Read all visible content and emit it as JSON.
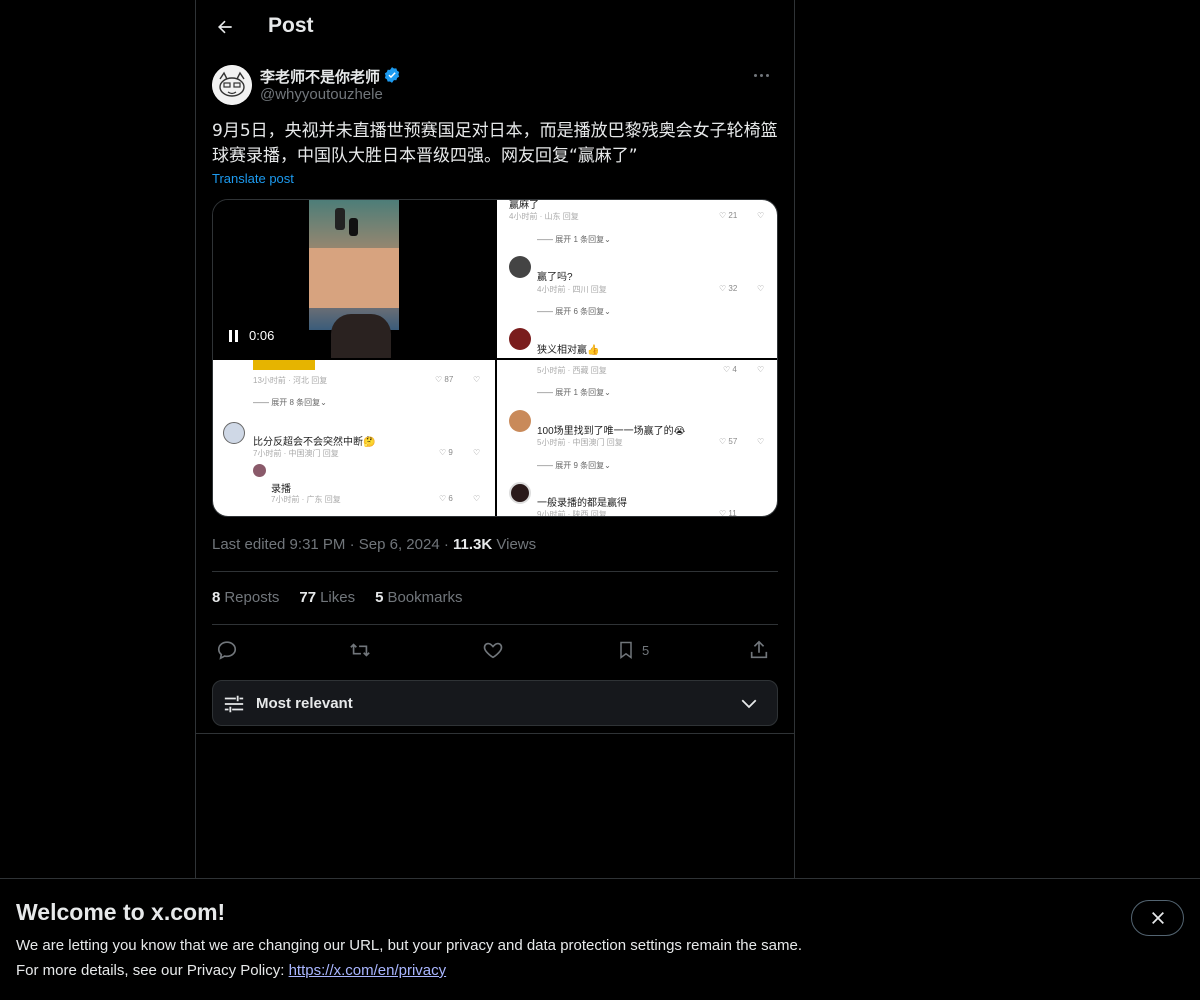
{
  "header": {
    "title": "Post"
  },
  "author": {
    "display_name": "李老师不是你老师",
    "handle": "@whyyoutouzhele"
  },
  "post": {
    "text": "9月5日，央视并未直播世预赛国足对日本，而是播放巴黎残奥会女子轮椅篮球赛录播，中国队大胜日本晋级四强。网友回复“赢麻了”",
    "translate_label": "Translate post"
  },
  "media": {
    "video_time": "0:06",
    "top_right": {
      "c1": {
        "text": "赢麻了",
        "meta": "4小时前 · 山东    回复",
        "likes": "21"
      },
      "c1_expand": "展开 1 条回复",
      "c2": {
        "text": "赢了吗?",
        "meta": "4小时前 · 四川    回复",
        "likes": "32"
      },
      "c2_expand": "展开 6 条回复",
      "c3": {
        "text": "狭义相对赢👍"
      }
    },
    "bottom_left": {
      "c0": {
        "meta": "13小时前 · 河北    回复",
        "likes": "87"
      },
      "c0_expand": "展开 8 条回复",
      "c1": {
        "text": "比分反超会不会突然中断🤔",
        "meta": "7小时前 · 中国澳门    回复",
        "likes": "9"
      },
      "c2": {
        "text": "录播",
        "meta": "7小时前 · 广东    回复",
        "likes": "6"
      }
    },
    "bottom_right": {
      "c0": {
        "meta": "5小时前 · 西藏    回复",
        "likes": "4"
      },
      "c0_expand": "展开 1 条回复",
      "c1": {
        "text": "100场里找到了唯一一场赢了的😭",
        "meta": "5小时前 · 中国澳门    回复",
        "likes": "57"
      },
      "c1_expand": "展开 9 条回复",
      "c2": {
        "text": "一般录播的都是赢得",
        "meta": "9小时前 · 陕西    回复",
        "likes": "11"
      }
    }
  },
  "meta": {
    "edited_time": "Last edited 9:31 PM",
    "date": "Sep 6, 2024",
    "views_count": "11.3K",
    "views_label": "Views"
  },
  "stats": {
    "reposts_count": "8",
    "reposts_label": "Reposts",
    "likes_count": "77",
    "likes_label": "Likes",
    "bookmarks_count": "5",
    "bookmarks_label": "Bookmarks"
  },
  "actions": {
    "bookmark_count": "5"
  },
  "sort": {
    "label": "Most relevant"
  },
  "banner": {
    "title": "Welcome to x.com!",
    "line1": "We are letting you know that we are changing our URL, but your privacy and data protection settings remain the same.",
    "line2_prefix": "For more details, see our Privacy Policy: ",
    "link": "https://x.com/en/privacy"
  },
  "colors": {
    "accent": "#1d9bf0",
    "background": "#000000",
    "muted_text": "#71767b",
    "border": "#2f3336",
    "banner_link": "#a9b6ff"
  },
  "icons": [
    "back-arrow-icon",
    "verified-badge-icon",
    "more-icon",
    "pause-icon",
    "reply-icon",
    "repost-icon",
    "like-icon",
    "bookmark-icon",
    "share-icon",
    "filter-sliders-icon",
    "chevron-down-icon",
    "close-icon"
  ]
}
